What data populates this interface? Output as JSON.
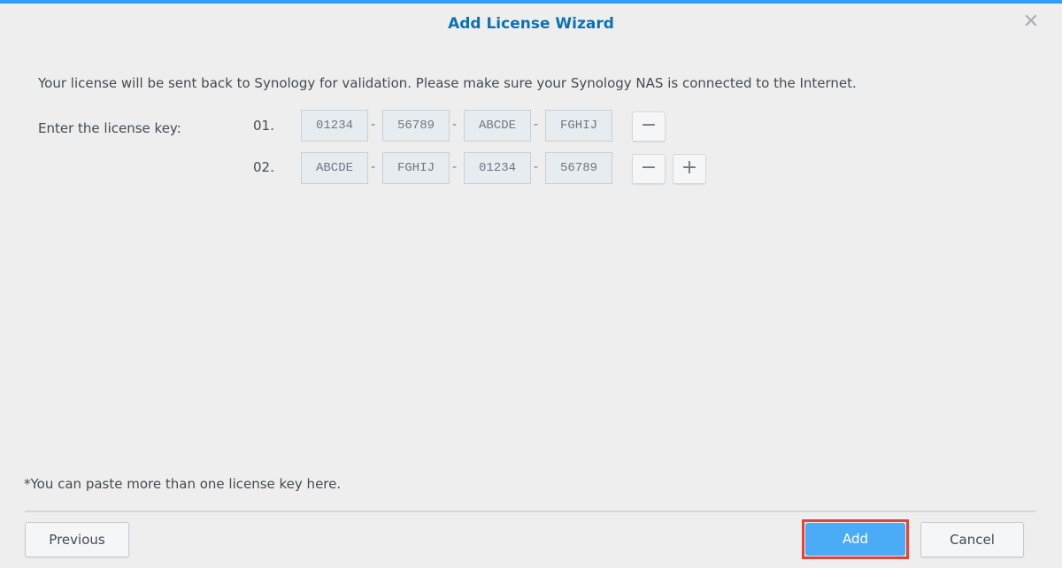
{
  "window": {
    "title": "Add License Wizard",
    "close_icon": "close-icon",
    "accent_color": "#2e9ff5"
  },
  "content": {
    "intro_text": "Your license will be sent back to Synology for validation. Please make sure your Synology NAS is connected to the Internet.",
    "key_label": "Enter the license key:",
    "separator": "-",
    "keys": [
      {
        "number": "01.",
        "segments": [
          "01234",
          "56789",
          "ABCDE",
          "FGHIJ"
        ],
        "remove_label": "−"
      },
      {
        "number": "02.",
        "segments": [
          "ABCDE",
          "FGHIJ",
          "01234",
          "56789"
        ],
        "remove_label": "−",
        "add_label": "+"
      }
    ],
    "note": "*You can paste more than one license key here."
  },
  "footer": {
    "previous_label": "Previous",
    "add_label": "Add",
    "cancel_label": "Cancel",
    "primary_color": "#4aacf6",
    "highlight_color": "#e0443a"
  }
}
